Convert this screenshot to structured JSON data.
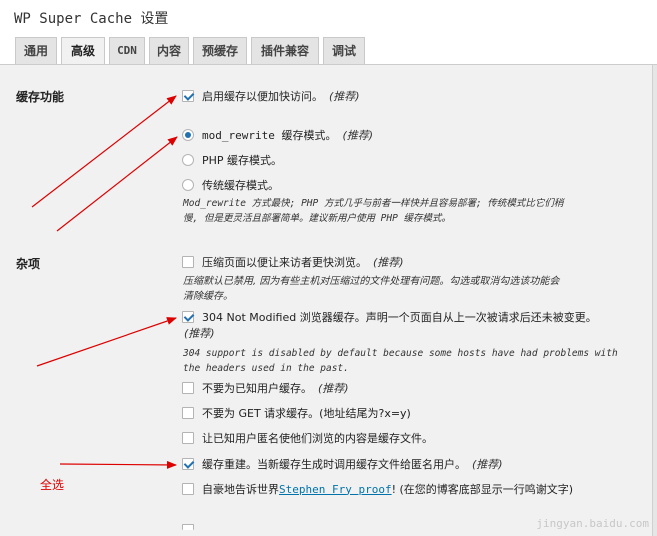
{
  "page_title": "WP Super Cache 设置",
  "tabs": [
    {
      "label": "通用"
    },
    {
      "label": "高级"
    },
    {
      "label": "CDN"
    },
    {
      "label": "内容"
    },
    {
      "label": "预缓存"
    },
    {
      "label": "插件兼容"
    },
    {
      "label": "调试"
    }
  ],
  "active_tab": "高级",
  "caching": {
    "label": "缓存功能",
    "enable": {
      "label": "启用缓存以便加快访问。",
      "note": "(推荐)",
      "checked": true
    },
    "modes": [
      {
        "label": "mod_rewrite 缓存模式。",
        "note": "(推荐)",
        "selected": true
      },
      {
        "label": "PHP 缓存模式。",
        "note": "",
        "selected": false
      },
      {
        "label": "传统缓存模式。",
        "note": "",
        "selected": false
      }
    ],
    "description": [
      "Mod_rewrite 方式最快; PHP 方式几乎与前者一样快并且容易部署; 传统模式比它们稍",
      "慢, 但是更灵活且部署简单。建议新用户使用 PHP 缓存模式。"
    ]
  },
  "misc": {
    "label": "杂项",
    "compress": {
      "label": "压缩页面以便让来访者更快浏览。",
      "note": "(推荐)",
      "checked": false
    },
    "compress_desc": [
      "压缩默认已禁用, 因为有些主机对压缩过的文件处理有问题。勾选或取消勾选该功能会",
      "清除缓存。"
    ],
    "not_modified": {
      "label": "304 Not Modified 浏览器缓存。声明一个页面自从上一次被请求后还未被变更。",
      "note": "(推荐)",
      "checked": true
    },
    "not_modified_desc": [
      "304 support is disabled by default because some hosts have had problems with",
      "the headers used in the past."
    ],
    "no_known_users": {
      "label": "不要为已知用户缓存。",
      "note": "(推荐)",
      "checked": false
    },
    "no_get": {
      "label": "不要为 GET 请求缓存。(地址结尾为?x=y)",
      "checked": false
    },
    "anonymous": {
      "label": "让已知用户匿名使他们浏览的内容是缓存文件。",
      "checked": false
    },
    "rebuild": {
      "label": "缓存重建。当新缓存生成时调用缓存文件给匿名用户。",
      "note": "(推荐)",
      "checked": true
    },
    "proud": {
      "label_before": "自豪地告诉世界",
      "link": "Stephen Fry proof",
      "label_after": "! (在您的博客底部显示一行鸣谢文字)",
      "checked": false
    }
  },
  "annotation": "全选",
  "watermark": "jingyan.baidu.com",
  "colors": {
    "arrow": "#dd0000",
    "check": "#2271b1",
    "panel": "#f1f1f1",
    "link": "#0073aa"
  }
}
